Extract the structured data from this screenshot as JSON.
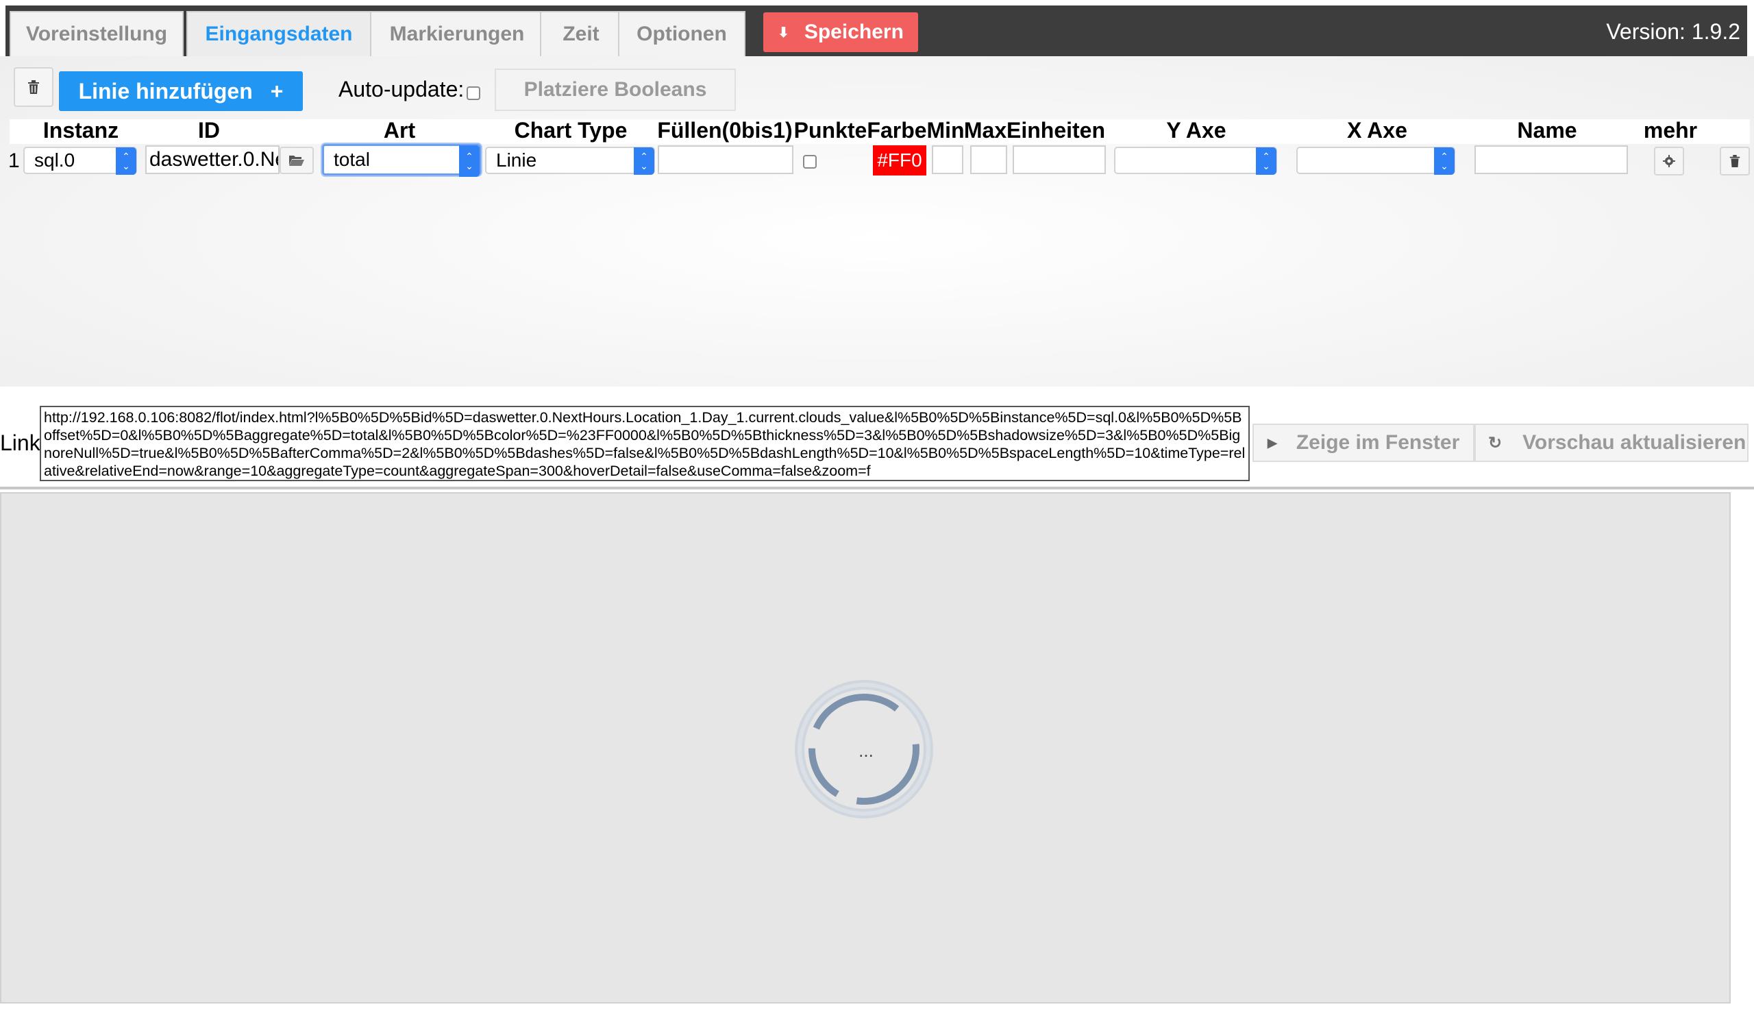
{
  "tabs": [
    {
      "label": "Voreinstellung",
      "active": false
    },
    {
      "label": "Eingangsdaten",
      "active": true
    },
    {
      "label": "Markierungen",
      "active": false
    },
    {
      "label": "Zeit",
      "active": false
    },
    {
      "label": "Optionen",
      "active": false
    }
  ],
  "toolbar": {
    "save_label": "Speichern",
    "version": "Version: 1.9.2",
    "add_line_label": "Linie hinzufügen",
    "add_line_plus": "+",
    "auto_update_label": "Auto-update:",
    "place_booleans_label": "Platziere Booleans"
  },
  "columns": {
    "instanz": "Instanz",
    "id": "ID",
    "art": "Art",
    "chart_type": "Chart Type",
    "fuellen": "Füllen(0bis1)",
    "punkte": "Punkte",
    "farbe": "Farbe",
    "min": "Min",
    "max": "Max",
    "einheiten": "Einheiten",
    "y_axe": "Y Axe",
    "x_axe": "X Axe",
    "name": "Name",
    "mehr": "mehr"
  },
  "row": {
    "index": "1",
    "instanz": "sql.0",
    "id": "daswetter.0.Ne",
    "art": "total",
    "chart_type": "Linie",
    "fuellen": "",
    "color": "#FF0",
    "min": "",
    "max": "",
    "einheiten": "",
    "y_axe": "",
    "x_axe": "",
    "name": ""
  },
  "link": {
    "label": "Link",
    "url": "http://192.168.0.106:8082/flot/index.html?l%5B0%5D%5Bid%5D=daswetter.0.NextHours.Location_1.Day_1.current.clouds_value&l%5B0%5D%5Binstance%5D=sql.0&l%5B0%5D%5Boffset%5D=0&l%5B0%5D%5Baggregate%5D=total&l%5B0%5D%5Bcolor%5D=%23FF0000&l%5B0%5D%5Bthickness%5D=3&l%5B0%5D%5Bshadowsize%5D=3&l%5B0%5D%5BignoreNull%5D=true&l%5B0%5D%5BafterComma%5D=2&l%5B0%5D%5Bdashes%5D=false&l%5B0%5D%5BdashLength%5D=10&l%5B0%5D%5BspaceLength%5D=10&timeType=relative&relativeEnd=now&range=10&aggregateType=count&aggregateSpan=300&hoverDetail=false&useComma=false&zoom=f",
    "show_window_label": "Zeige im Fenster",
    "refresh_preview_label": "Vorschau aktualisieren"
  },
  "preview": {
    "spinner_text": "..."
  },
  "colors": {
    "accent": "#2196f3",
    "save": "#f25f5f",
    "header_bg": "#3d3d3d",
    "line_color": "#ff0000"
  }
}
